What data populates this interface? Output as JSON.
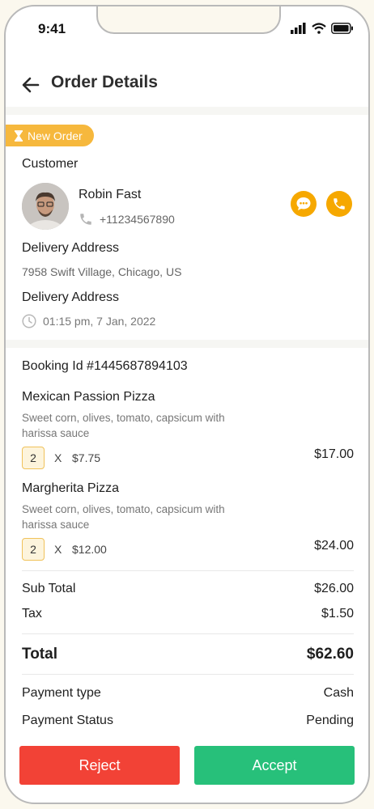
{
  "status_bar": {
    "time": "9:41"
  },
  "header": {
    "title": "Order Details"
  },
  "badge": {
    "label": "New Order"
  },
  "customer": {
    "section_label": "Customer",
    "name": "Robin Fast",
    "phone": "+11234567890"
  },
  "delivery": {
    "address_label": "Delivery Address",
    "address": "7958 Swift Village, Chicago, US",
    "time_label": "Delivery Address",
    "time": "01:15 pm, 7 Jan, 2022"
  },
  "booking": {
    "label": "Booking Id #1445687894103"
  },
  "items": [
    {
      "name": "Mexican Passion Pizza",
      "description": "Sweet corn, olives, tomato, capsicum with harissa sauce",
      "qty": "2",
      "times": "X",
      "unit_price": "$7.75",
      "line_total": "$17.00"
    },
    {
      "name": "Margherita Pizza",
      "description": "Sweet corn, olives, tomato, capsicum with harissa sauce",
      "qty": "2",
      "times": "X",
      "unit_price": "$12.00",
      "line_total": "$24.00"
    }
  ],
  "summary": {
    "subtotal_label": "Sub Total",
    "subtotal": "$26.00",
    "tax_label": "Tax",
    "tax": "$1.50",
    "total_label": "Total",
    "total": "$62.60",
    "payment_type_label": "Payment type",
    "payment_type": "Cash",
    "payment_status_label": "Payment Status",
    "payment_status": "Pending"
  },
  "actions": {
    "reject": "Reject",
    "accept": "Accept"
  },
  "colors": {
    "badge": "#f6b83d",
    "accent": "#f6a800",
    "reject": "#f24236",
    "accept": "#27c07a"
  },
  "icons": [
    "back-arrow-icon",
    "hourglass-icon",
    "phone-icon",
    "chat-icon",
    "clock-icon",
    "signal-icon",
    "wifi-icon",
    "battery-icon"
  ]
}
